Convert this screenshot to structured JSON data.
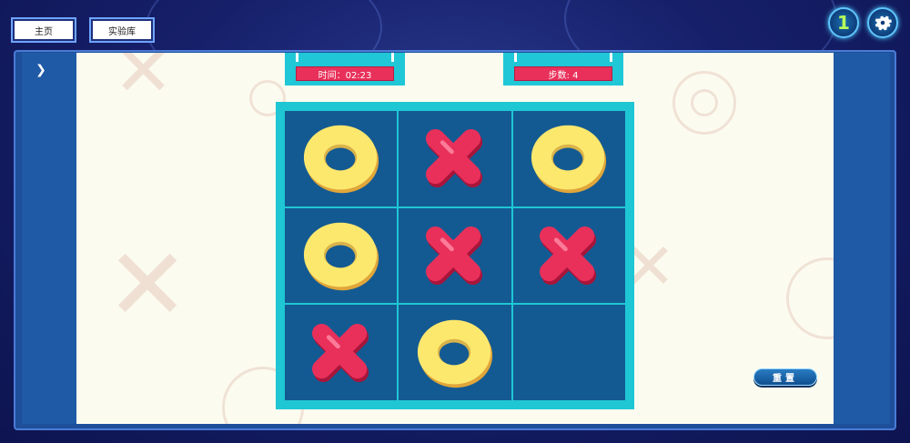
{
  "nav": {
    "home_label": "主页",
    "lab_label": "实验库"
  },
  "top_right": {
    "badge_text": "1",
    "settings_icon": "gear-icon"
  },
  "hud": {
    "time_text": "时间：02:23",
    "steps_text": "步数: 4"
  },
  "board": {
    "cells": [
      "O",
      "X",
      "O",
      "O",
      "X",
      "X",
      "X",
      "O",
      ""
    ]
  },
  "reset_label": "重置",
  "colors": {
    "board_cell": "#145a92",
    "board_border": "#1fc6d4",
    "x_mark": "#e8305a",
    "o_mark": "#fde86e",
    "hud_value": "#e8305a"
  }
}
